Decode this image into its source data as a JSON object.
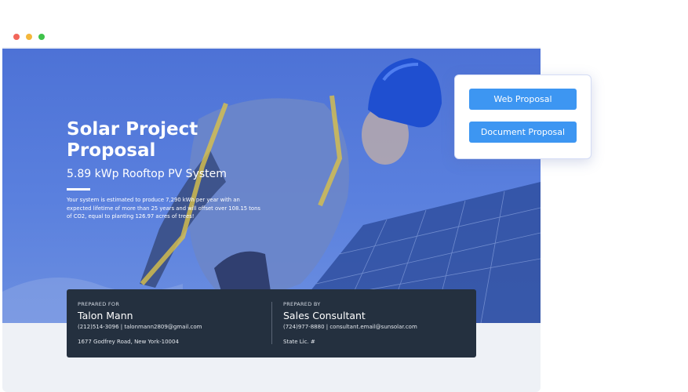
{
  "window": {
    "dot_colors": [
      "#f2665a",
      "#f4b73c",
      "#3fc24b"
    ]
  },
  "hero": {
    "title": "Solar Project Proposal",
    "subtitle": "5.89 kWp Rooftop PV System",
    "description": "Your system is estimated to produce 7,290 kWh per year with an expected lifetime of more than 25 years and will offset over 108.15 tons of CO2, equal to planting 126.97 acres of trees!"
  },
  "prepared_for": {
    "label": "PREPARED FOR",
    "name": "Talon Mann",
    "contact": "(212)514-3096 | talonmann2809@gmail.com",
    "address": "1677 Godfrey Road, New York-10004"
  },
  "prepared_by": {
    "label": "PREPARED BY",
    "name": "Sales Consultant",
    "contact": "(724)977-8880 | consultant.email@sunsolar.com",
    "license": "State Lic. #"
  },
  "actions": {
    "web_proposal": "Web Proposal",
    "document_proposal": "Document Proposal"
  },
  "colors": {
    "accent_button": "#3d96f2",
    "card_bg": "#24303f",
    "hero_overlay": "#4d72d6"
  }
}
